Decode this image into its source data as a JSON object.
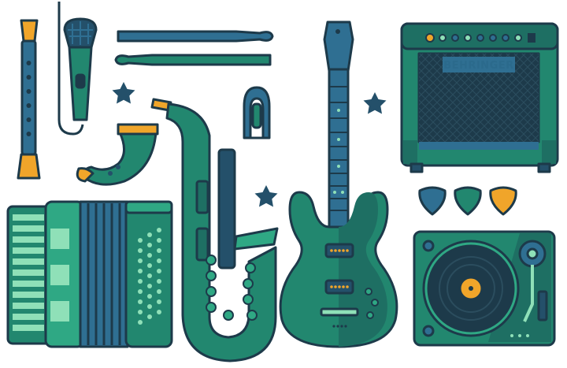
{
  "illustration": {
    "amp_brand_text": "BEHRINGER",
    "colors": {
      "outline": "#1d3a4a",
      "teal_dark": "#1e6f63",
      "teal": "#22876f",
      "teal_light": "#2fa884",
      "mint": "#8fe0b8",
      "blue": "#2f6f92",
      "navy": "#24506a",
      "orange": "#f0a52a",
      "background": "#ffffff"
    }
  }
}
